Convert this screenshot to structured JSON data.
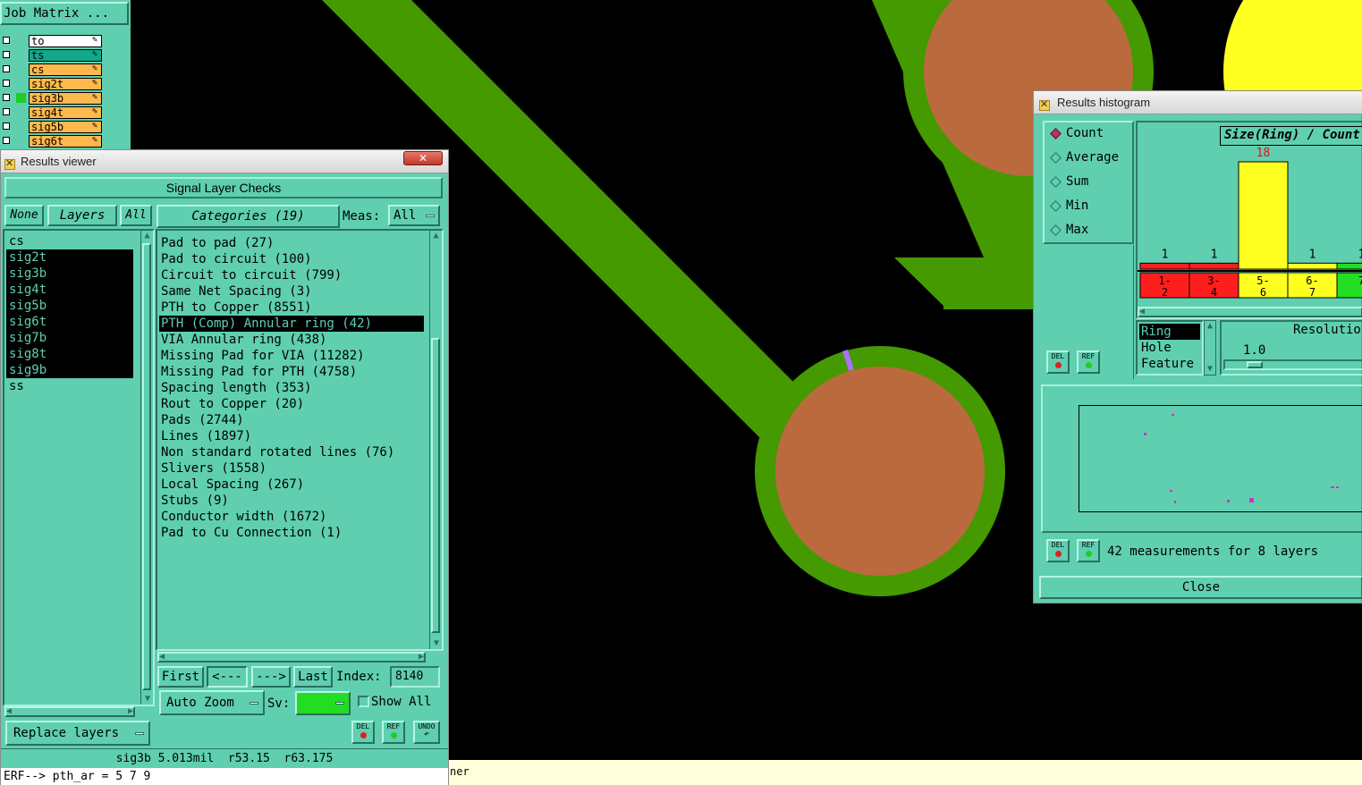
{
  "job_matrix": {
    "title": "Job Matrix ...",
    "layers": [
      {
        "name": "to",
        "bg": "#ffffff",
        "fg": "#000000",
        "marker": false
      },
      {
        "name": "ts",
        "bg": "#12a88c",
        "fg": "#000000",
        "marker": false
      },
      {
        "name": "cs",
        "bg": "#ffb84d",
        "fg": "#000000",
        "marker": false
      },
      {
        "name": "sig2t",
        "bg": "#ffb84d",
        "fg": "#000000",
        "marker": false
      },
      {
        "name": "sig3b",
        "bg": "#ffb84d",
        "fg": "#000000",
        "marker": true
      },
      {
        "name": "sig4t",
        "bg": "#ffb84d",
        "fg": "#000000",
        "marker": false
      },
      {
        "name": "sig5b",
        "bg": "#ffb84d",
        "fg": "#000000",
        "marker": false
      },
      {
        "name": "sig6t",
        "bg": "#ffb84d",
        "fg": "#000000",
        "marker": false
      }
    ]
  },
  "results_viewer": {
    "window_title": "Results viewer",
    "close_glyph": "✕",
    "section_title": "Signal Layer Checks",
    "btn_none": "None",
    "btn_layers": "Layers",
    "btn_all": "All",
    "btn_categories": "Categories (19)",
    "meas_label": "Meas:",
    "meas_value": "All",
    "layers": [
      "cs",
      "sig2t",
      "sig3b",
      "sig4t",
      "sig5b",
      "sig6t",
      "sig7b",
      "sig8t",
      "sig9b",
      "ss"
    ],
    "selected_layers": [
      1,
      2,
      3,
      4,
      5,
      6,
      7,
      8
    ],
    "categories": [
      "Pad to pad (27)",
      "Pad to circuit (100)",
      "Circuit to circuit (799)",
      "Same Net Spacing (3)",
      "PTH to Copper (8551)",
      "PTH (Comp) Annular ring (42)",
      "VIA Annular ring (438)",
      "Missing Pad for VIA (11282)",
      "Missing Pad for PTH (4758)",
      "Spacing length (353)",
      "Rout to Copper (20)",
      "Pads (2744)",
      "Lines (1897)",
      "Non standard rotated lines (76)",
      "Slivers (1558)",
      "Local Spacing (267)",
      "Stubs (9)",
      "Conductor width (1672)",
      "Pad to Cu Connection (1)"
    ],
    "selected_category": 5,
    "nav_first": "First",
    "nav_prev": "<---",
    "nav_next": "--->",
    "nav_last": "Last",
    "index_label": "Index:",
    "index_value": "8140",
    "auto_zoom": "Auto Zoom",
    "sv_label": "Sv:",
    "show_all": "Show All",
    "replace_layers": "Replace layers",
    "del": "DEL",
    "ref": "REF",
    "undo": "UNDO",
    "status": "sig3b 5.013mil  r53.15  r63.175",
    "command": "ERF--> pth_ar = 5 7 9",
    "command_tail": "ner"
  },
  "histogram": {
    "window_title": "Results histogram",
    "options": [
      "Count",
      "Average",
      "Sum",
      "Min",
      "Max"
    ],
    "selected_option": 0,
    "chart_title": "Size(Ring) / Count",
    "bars": [
      {
        "label_a": "1-",
        "label_b": "2",
        "value": "1",
        "color": "#ff1e1e"
      },
      {
        "label_a": "3-",
        "label_b": "4",
        "value": "1",
        "color": "#ff1e1e"
      },
      {
        "label_a": "5-",
        "label_b": "6",
        "value": "18",
        "color": "#ffff20"
      },
      {
        "label_a": "6-",
        "label_b": "7",
        "value": "1",
        "color": "#ffff20"
      },
      {
        "label_a": "7",
        "label_b": "",
        "value": "1",
        "color": "#22dd22"
      }
    ],
    "peak_value_color": "#e01010",
    "attributes": [
      "Ring",
      "Hole",
      "Feature"
    ],
    "selected_attribute": 0,
    "resolution_label": "Resolutio",
    "resolution_value": "1.0",
    "summary": "42 measurements for 8 layers",
    "close": "Close",
    "del": "DEL",
    "ref": "REF"
  }
}
